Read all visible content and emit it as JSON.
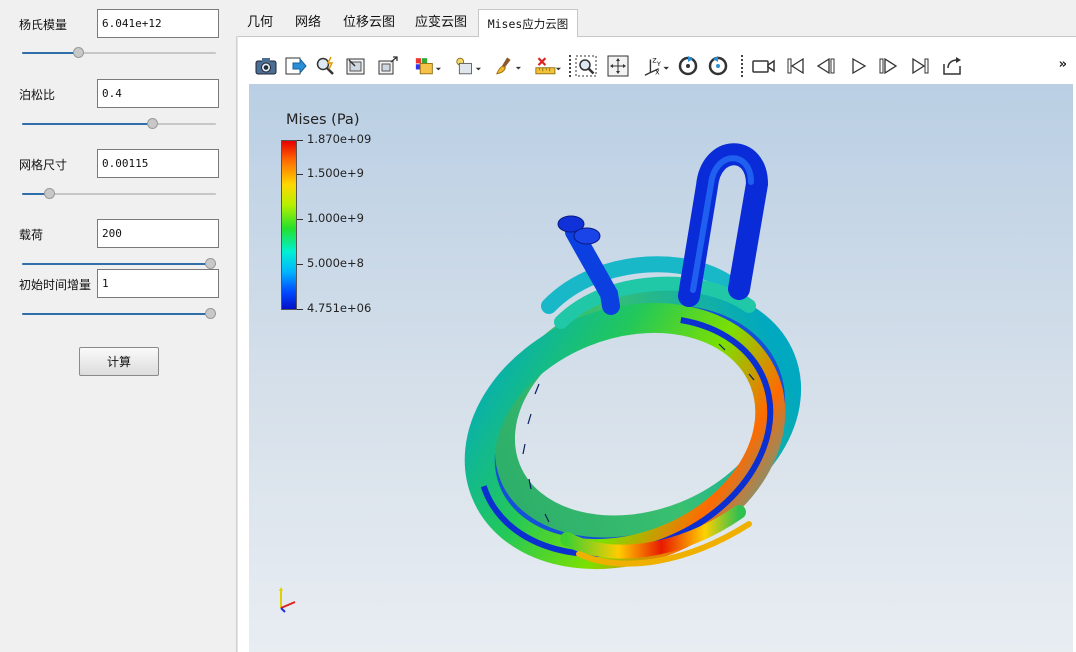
{
  "params": [
    {
      "label": "杨氏模量",
      "value": "6.041e+12",
      "slider_fraction": 0.29
    },
    {
      "label": "泊松比",
      "value": "0.4",
      "slider_fraction": 0.67
    },
    {
      "label": "网格尺寸",
      "value": "0.00115",
      "slider_fraction": 0.14
    },
    {
      "label": "载荷",
      "value": "200",
      "slider_fraction": 1.0
    },
    {
      "label": "初始时间增量",
      "value": "1",
      "slider_fraction": 1.0
    }
  ],
  "calc_button": "计算",
  "tabs": [
    {
      "label": "几何",
      "active": false
    },
    {
      "label": "网络",
      "active": false
    },
    {
      "label": "位移云图",
      "active": false
    },
    {
      "label": "应变云图",
      "active": false
    },
    {
      "label": "Mises应力云图",
      "active": true
    }
  ],
  "toolbar": {
    "icons": [
      "camera-icon",
      "export-icon",
      "zoom-select-icon",
      "reset-view-icon",
      "fit-view-icon",
      "render-mode-icon",
      "representation-icon",
      "clear-icon",
      "ruler-icon",
      "zoom-box-icon",
      "pan-icon",
      "axes-orientation-icon",
      "rotate-cw-icon",
      "rotate-ccw-icon",
      "video-camera-icon",
      "first-frame-icon",
      "prev-frame-icon",
      "play-icon",
      "next-frame-icon",
      "last-frame-icon",
      "loop-icon"
    ],
    "more": "»"
  },
  "legend": {
    "title": "Mises (Pa)",
    "labels": [
      "1.870e+09",
      "1.500e+9",
      "1.000e+9",
      "5.000e+8",
      "4.751e+06"
    ],
    "colors": {
      "max": "#e60000",
      "min": "#0010c8"
    }
  },
  "axes": {
    "x": "x",
    "y": "y",
    "z": "z"
  }
}
